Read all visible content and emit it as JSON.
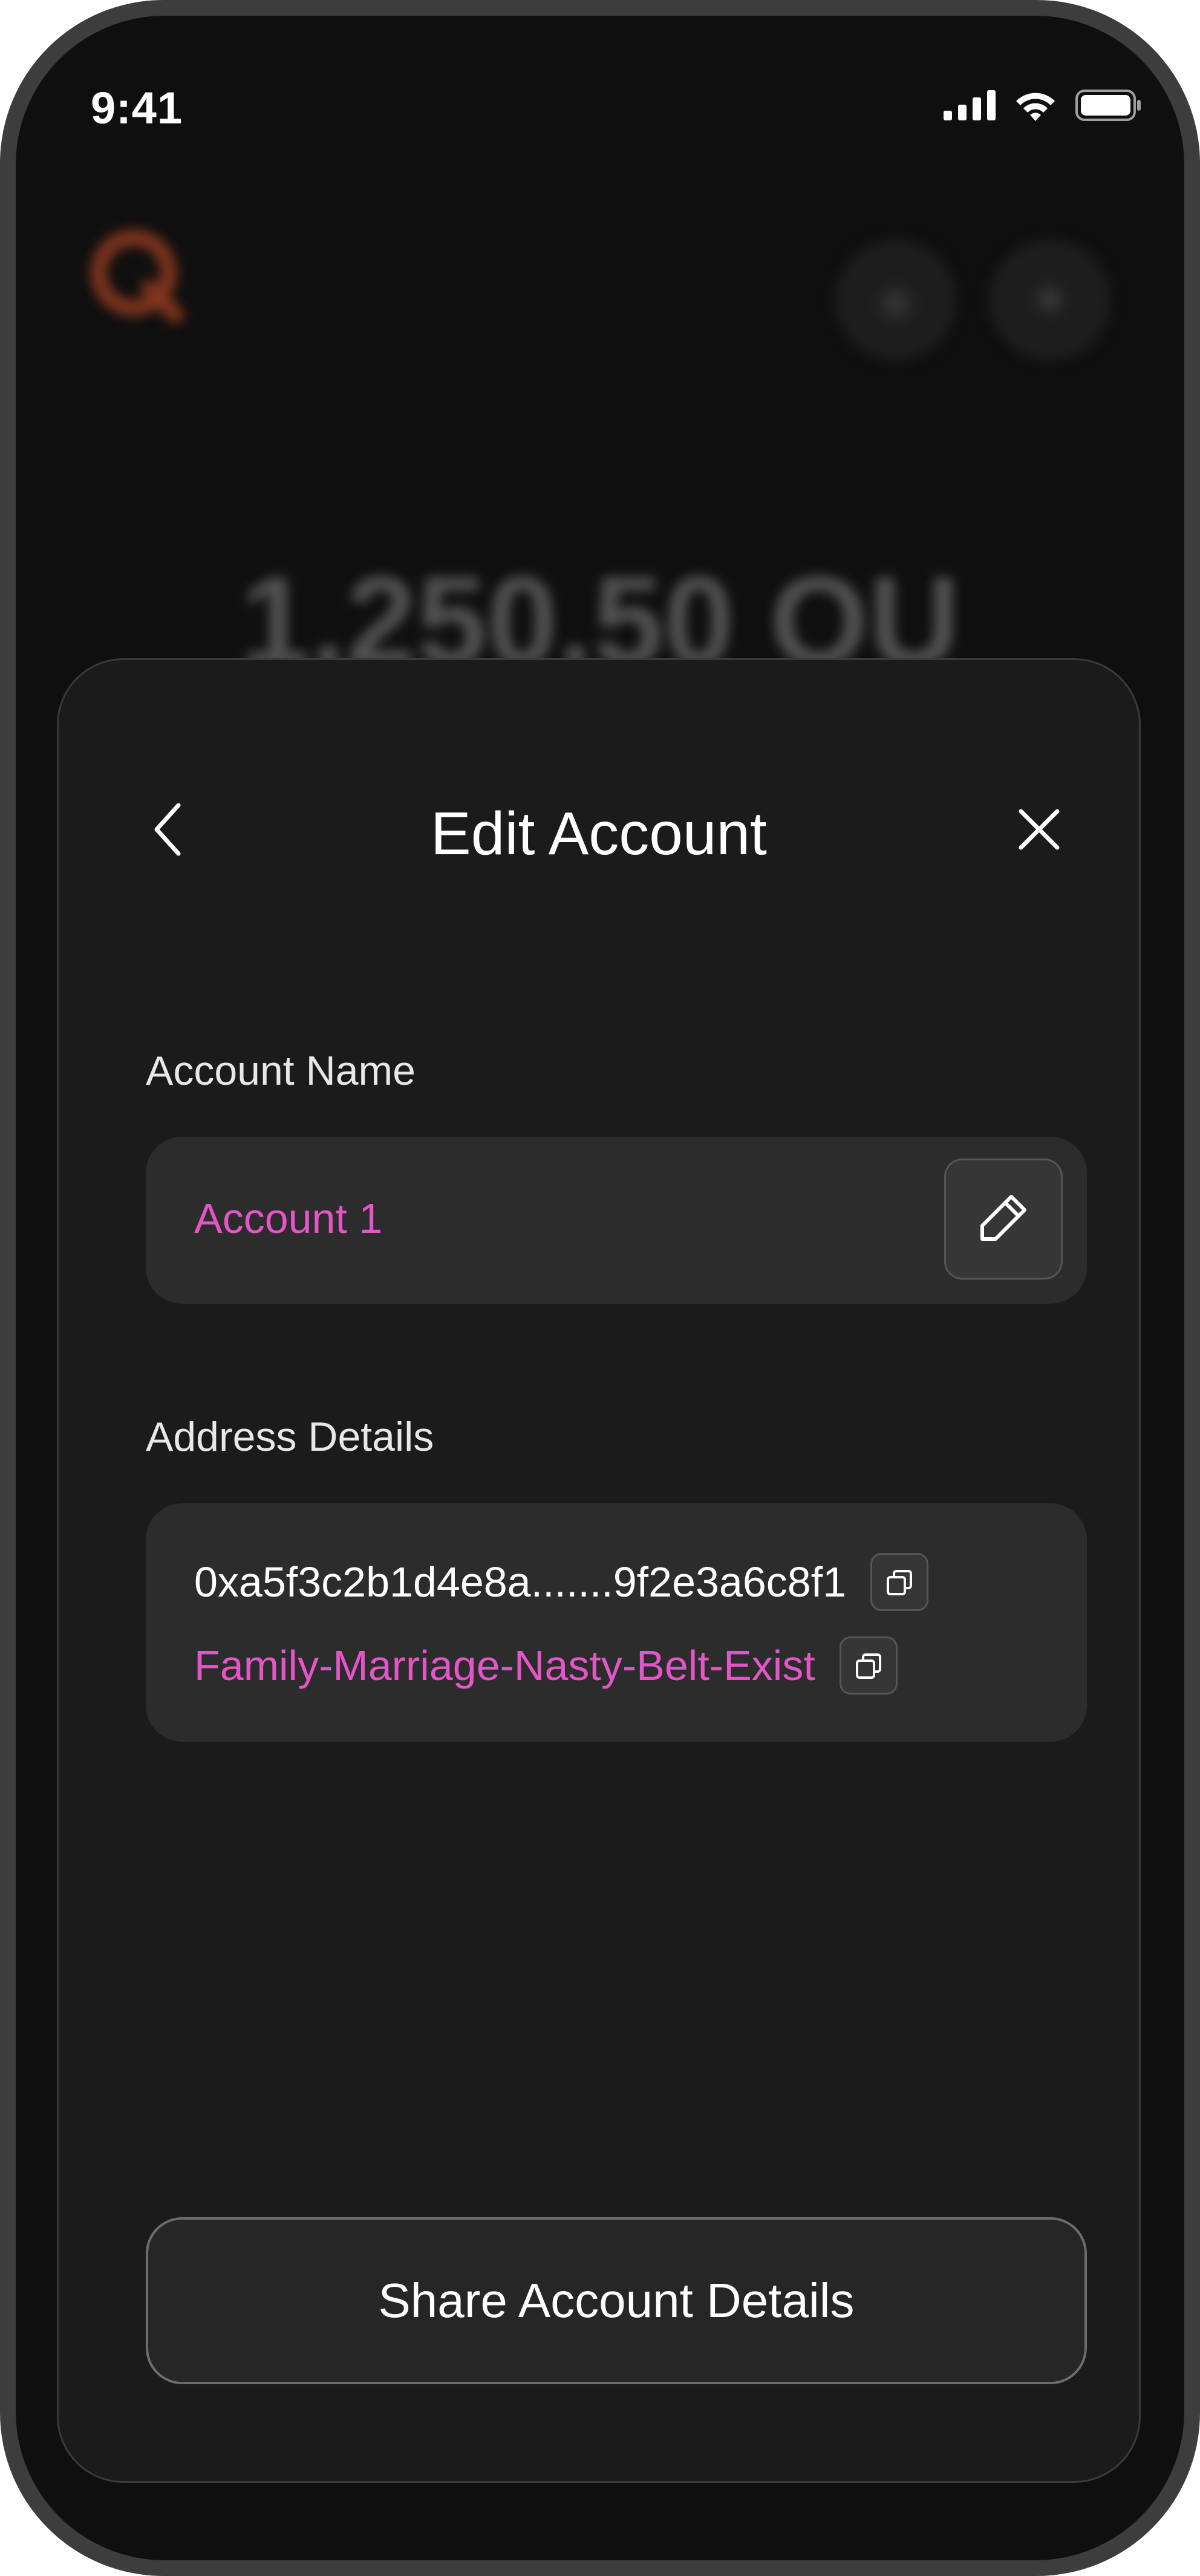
{
  "status_bar": {
    "time": "9:41"
  },
  "background": {
    "logo_icon": "qubic-logo-icon",
    "balance": "1,250.50 QU",
    "accent": "#e0552a"
  },
  "sheet": {
    "title": "Edit Account",
    "back_icon": "chevron-left-icon",
    "close_icon": "close-icon"
  },
  "account_name": {
    "label": "Account Name",
    "value": "Account 1",
    "edit_icon": "pencil-icon"
  },
  "address_details": {
    "label": "Address Details",
    "address": "0xa5f3c2b1d4e8a.......9f2e3a6c8f1",
    "phrase": "Family-Marriage-Nasty-Belt-Exist",
    "copy_icon": "copy-icon"
  },
  "share_button": {
    "label": "Share Account Details"
  },
  "colors": {
    "highlight": "#e455c8",
    "sheet_bg": "#1b1b1b",
    "field_bg": "#2c2c2c"
  }
}
